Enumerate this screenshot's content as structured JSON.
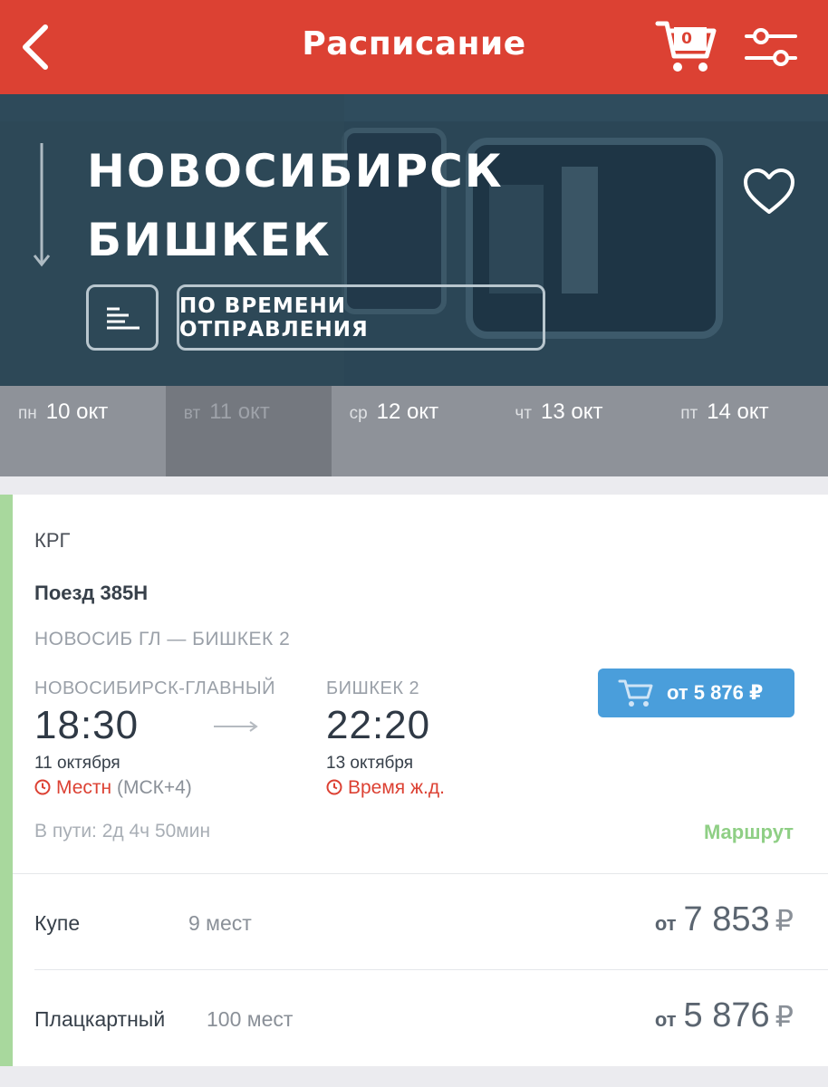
{
  "header": {
    "title": "Расписание",
    "cart_count": "0",
    "colors": {
      "bar": "#dc4133"
    },
    "icons": [
      "back-arrow-icon",
      "cart-icon",
      "filter-sliders-icon"
    ]
  },
  "hero": {
    "from_city": "НОВОСИБИРСК",
    "to_city": "БИШКЕК",
    "sort_label": "ПО ВРЕМЕНИ ОТПРАВЛЕНИЯ",
    "icons": [
      "direction-arrow-icon",
      "heart-icon",
      "sort-bars-icon"
    ]
  },
  "dates": [
    {
      "dow": "пн",
      "date": "10 окт"
    },
    {
      "dow": "вт",
      "date": "11 окт",
      "selected": true
    },
    {
      "dow": "ср",
      "date": "12 окт"
    },
    {
      "dow": "чт",
      "date": "13 окт"
    },
    {
      "dow": "пт",
      "date": "14 окт"
    }
  ],
  "train": {
    "carrier": "КРГ",
    "number": "Поезд 385Н",
    "route": "НОВОСИБ ГЛ — БИШКЕК 2",
    "departure": {
      "station": "НОВОСИБИРСК-ГЛАВНЫЙ",
      "time": "18:30",
      "date": "11 октября",
      "tz_label": "Местн",
      "tz_offset": "(МСК+4)"
    },
    "arrival": {
      "station": "БИШКЕК 2",
      "time": "22:20",
      "date": "13 октября",
      "tz_label": "Время ж.д."
    },
    "min_price_label": "от 5 876 ₽",
    "duration": "В пути: 2д 4ч 50мин",
    "route_link": "Маршрут",
    "seat_classes": [
      {
        "name": "Купе",
        "seats": "9 мест",
        "price_prefix": "от",
        "price": "7 853",
        "currency": "₽"
      },
      {
        "name": "Плацкартный",
        "seats": "100 мест",
        "price_prefix": "от",
        "price": "5 876",
        "currency": "₽"
      }
    ],
    "colors": {
      "accent_green": "#a8d89d",
      "button_blue": "#4a9edb",
      "warning_red": "#dc4133"
    }
  }
}
